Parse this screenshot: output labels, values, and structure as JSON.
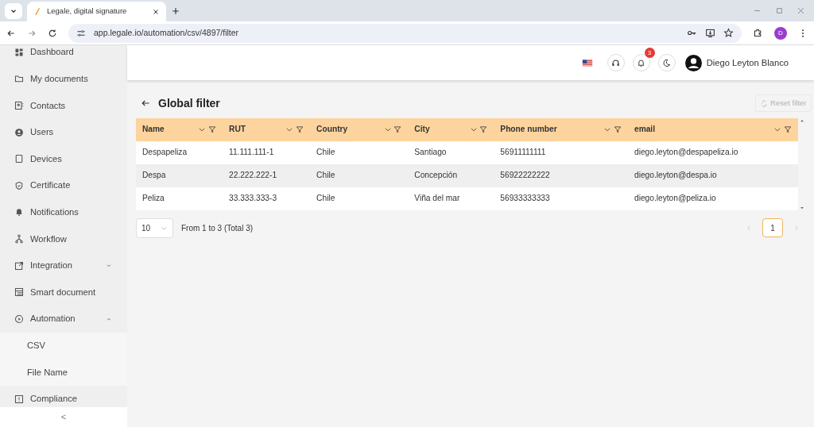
{
  "browser": {
    "tabs": [
      {
        "title": "Legale, digital signature",
        "selected": true
      }
    ],
    "url": "app.legale.io/automation/csv/4897/filter",
    "profile_initial": "D"
  },
  "sidebar": {
    "items": [
      {
        "label": "Dashboard"
      },
      {
        "label": "My documents"
      },
      {
        "label": "Contacts"
      },
      {
        "label": "Users"
      },
      {
        "label": "Devices"
      },
      {
        "label": "Certificate"
      },
      {
        "label": "Notifications"
      },
      {
        "label": "Workflow"
      },
      {
        "label": "Integration",
        "expanded": false
      },
      {
        "label": "Smart document"
      },
      {
        "label": "Automation",
        "expanded": true,
        "children": [
          {
            "label": "CSV"
          },
          {
            "label": "File Name"
          }
        ]
      },
      {
        "label": "Compliance"
      }
    ],
    "collapse_label": "<"
  },
  "header": {
    "notification_count": "3",
    "user_name": "Diego Leyton Blanco"
  },
  "page": {
    "title": "Global filter",
    "reset_button": {
      "label": "Reset filter",
      "disabled": true
    }
  },
  "table": {
    "columns": [
      "Name",
      "RUT",
      "Country",
      "City",
      "Phone number",
      "email"
    ],
    "rows": [
      {
        "highlighted": false,
        "cells": [
          "Despapeliza",
          "11.111.111-1",
          "Chile",
          "Santiago",
          "56911111111",
          "diego.leyton@despapeliza.io"
        ]
      },
      {
        "highlighted": true,
        "cells": [
          "Despa",
          "22.222.222-1",
          "Chile",
          "Concepción",
          "56922222222",
          "diego.leyton@despa.io"
        ]
      },
      {
        "highlighted": false,
        "cells": [
          "Peliza",
          "33.333.333-3",
          "Chile",
          "Viña del mar",
          "56933333333",
          "diego.leyton@peliza.io"
        ]
      }
    ]
  },
  "pagination": {
    "page_size": "10",
    "summary": "From 1 to 3 (Total 3)",
    "pages": [
      {
        "label": "1",
        "selected": true
      }
    ]
  }
}
